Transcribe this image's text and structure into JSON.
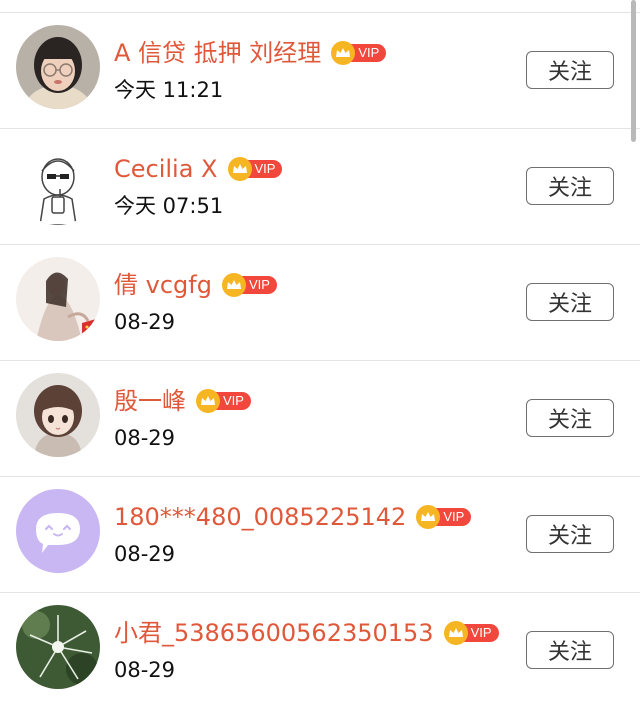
{
  "vip_label": "VIP",
  "follow_label": "关注",
  "colors": {
    "name": "#e0583a",
    "vip_badge": "#f2473d",
    "crown": "#f6b523"
  },
  "users": [
    {
      "name": "A 信贷 抵押 刘经理",
      "time": "今天 11:21",
      "avatar": "woman-glasses-avatar"
    },
    {
      "name": "Cecilia X",
      "time": "今天 07:51",
      "avatar": "sketch-girl-avatar"
    },
    {
      "name": "倩 vcgfg",
      "time": "08-29",
      "avatar": "costume-woman-avatar"
    },
    {
      "name": "殷一峰",
      "time": "08-29",
      "avatar": "anime-girl-avatar"
    },
    {
      "name": "180***480_0085225142",
      "time": "08-29",
      "avatar": "chat-bubble-avatar"
    },
    {
      "name": "小君_53865600562350153",
      "time": "08-29",
      "avatar": "plant-photo-avatar"
    }
  ]
}
